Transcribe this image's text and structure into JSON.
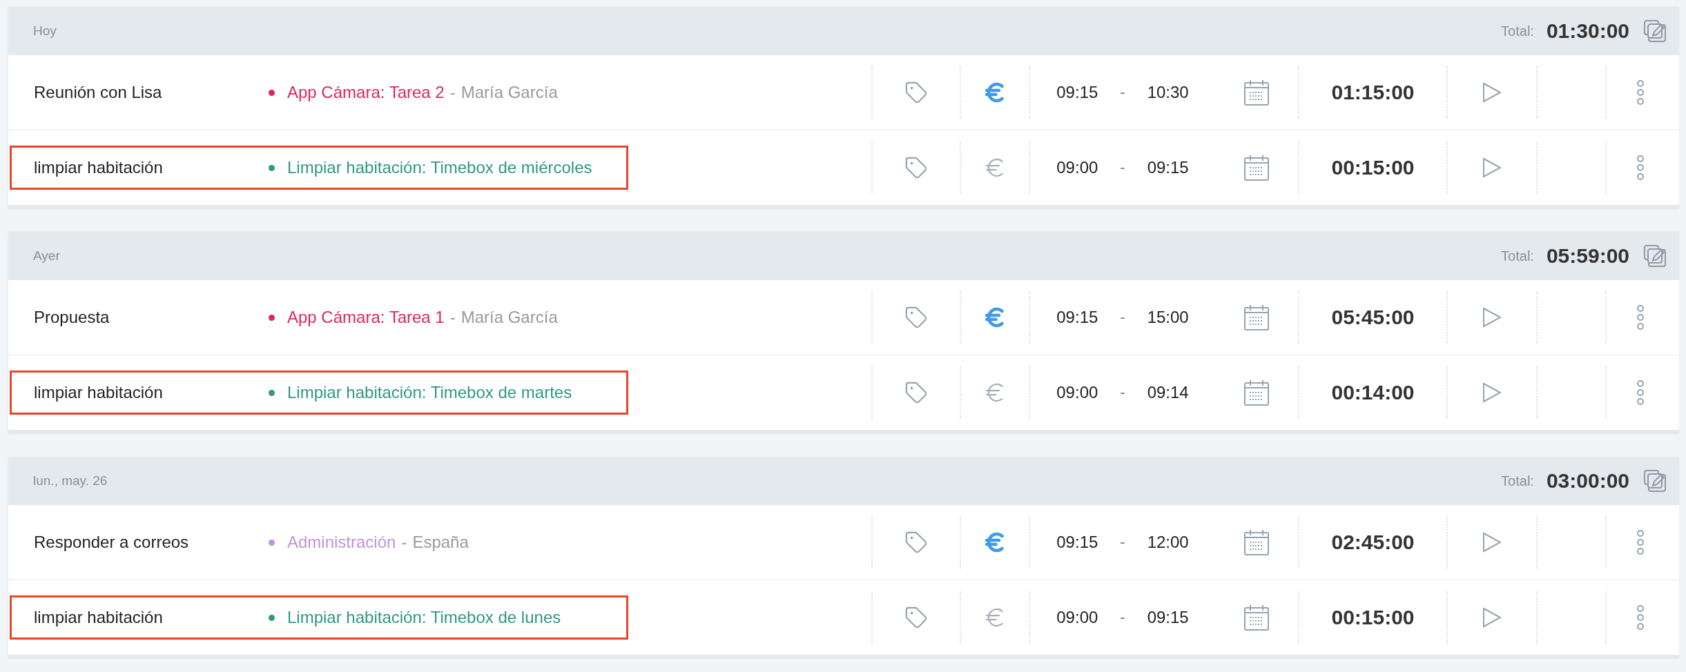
{
  "groups": [
    {
      "date": "Hoy",
      "total_label": "Total:",
      "total": "01:30:00",
      "entries": [
        {
          "description": "Reunión con Lisa",
          "project": "App Cámara: Tarea 2",
          "client_separator": "-",
          "client": "María García",
          "color": "#e0245e",
          "billable": true,
          "start": "09:15",
          "separator": "-",
          "end": "10:30",
          "duration": "01:15:00",
          "highlighted": false
        },
        {
          "description": "limpiar habitación",
          "project": "Limpiar habitación: Timebox de miércoles",
          "color": "#2e9882",
          "billable": false,
          "start": "09:00",
          "separator": "-",
          "end": "09:15",
          "duration": "00:15:00",
          "highlighted": true
        }
      ]
    },
    {
      "date": "Ayer",
      "total_label": "Total:",
      "total": "05:59:00",
      "entries": [
        {
          "description": "Propuesta",
          "project": "App Cámara: Tarea 1",
          "client_separator": "-",
          "client": "María García",
          "color": "#e0245e",
          "billable": true,
          "start": "09:15",
          "separator": "-",
          "end": "15:00",
          "duration": "05:45:00",
          "highlighted": false
        },
        {
          "description": "limpiar habitación",
          "project": "Limpiar habitación: Timebox de martes",
          "color": "#2e9882",
          "billable": false,
          "start": "09:00",
          "separator": "-",
          "end": "09:14",
          "duration": "00:14:00",
          "highlighted": true
        }
      ]
    },
    {
      "date": "lun., may. 26",
      "total_label": "Total:",
      "total": "03:00:00",
      "entries": [
        {
          "description": "Responder a correos",
          "project": "Administración",
          "client_separator": "-",
          "client": "España",
          "color": "#c393d6",
          "billable": true,
          "start": "09:15",
          "separator": "-",
          "end": "12:00",
          "duration": "02:45:00",
          "highlighted": false
        },
        {
          "description": "limpiar habitación",
          "project": "Limpiar habitación: Timebox de lunes",
          "color": "#2e9882",
          "billable": false,
          "start": "09:00",
          "separator": "-",
          "end": "09:15",
          "duration": "00:15:00",
          "highlighted": true
        }
      ]
    }
  ]
}
